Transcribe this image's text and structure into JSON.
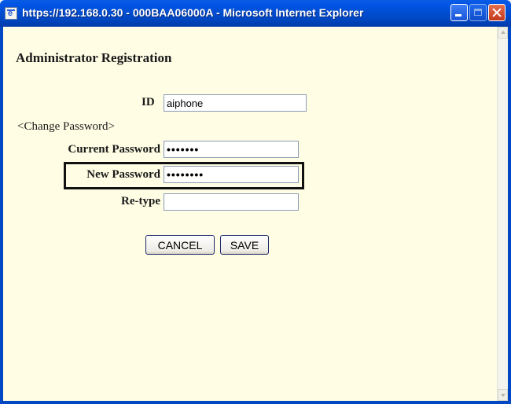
{
  "window": {
    "title": "https://192.168.0.30 - 000BAA06000A - Microsoft Internet Explorer",
    "icon": "ie-page-icon",
    "controls": [
      "minimize-icon",
      "maximize-icon",
      "close-icon"
    ],
    "colors": {
      "titlebar": "#0054e3",
      "page_background": "#fffde4",
      "close_button": "#c4391c"
    }
  },
  "page": {
    "title": "Administrator Registration",
    "id_label": "ID",
    "id_value": "aiphone",
    "section_label": "<Change Password>",
    "current_password_label": "Current Password",
    "current_password_value": "•••••••",
    "new_password_label": "New Password",
    "new_password_value": "••••••••",
    "retype_label": "Re-type",
    "retype_value": "",
    "cancel_label": "CANCEL",
    "save_label": "SAVE"
  }
}
